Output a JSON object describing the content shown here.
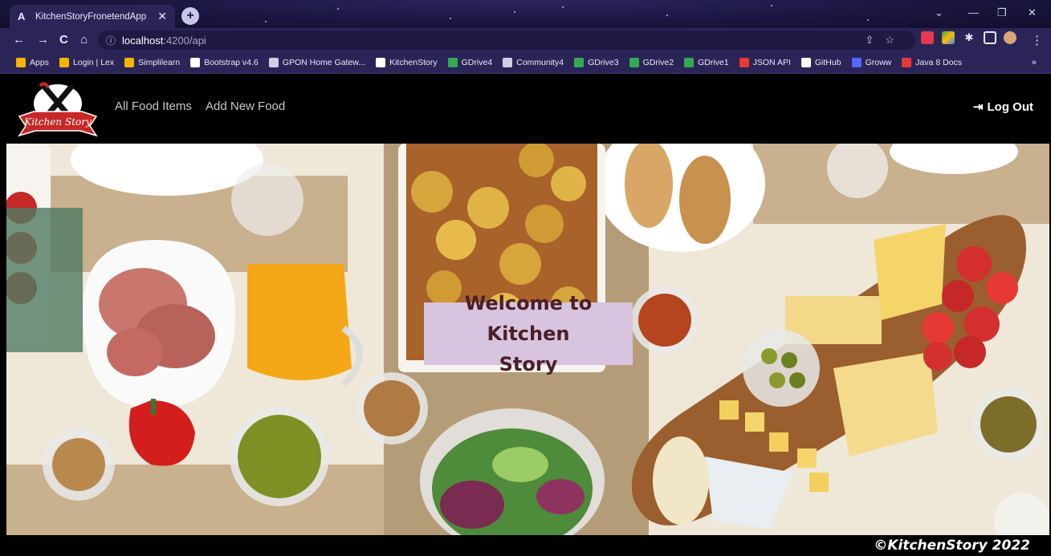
{
  "browser": {
    "tab_title": "KitchenStoryFronetendApp",
    "tab_favicon": "A",
    "url_host": "localhost",
    "url_path": ":4200/api",
    "bookmarks": [
      {
        "label": "Apps",
        "icon": "apps-grid-icon",
        "color": "#f4b400"
      },
      {
        "label": "Login | Lex",
        "icon": "lex-icon",
        "color": "#f4b400"
      },
      {
        "label": "Simplilearn",
        "icon": "simplilearn-icon",
        "color": "#f4b400"
      },
      {
        "label": "Bootstrap v4.6",
        "icon": "bootstrap-icon",
        "color": "#ffffff"
      },
      {
        "label": "GPON Home Gatew...",
        "icon": "globe-icon",
        "color": "#cfcde8"
      },
      {
        "label": "KitchenStory",
        "icon": "angular-icon",
        "color": "#ffffff"
      },
      {
        "label": "GDrive4",
        "icon": "gdrive-icon",
        "color": "#34a853"
      },
      {
        "label": "Community4",
        "icon": "globe-icon",
        "color": "#cfcde8"
      },
      {
        "label": "GDrive3",
        "icon": "gdrive-icon",
        "color": "#34a853"
      },
      {
        "label": "GDrive2",
        "icon": "gdrive-icon",
        "color": "#34a853"
      },
      {
        "label": "GDrive1",
        "icon": "gdrive-icon",
        "color": "#34a853"
      },
      {
        "label": "JSON API",
        "icon": "json-icon",
        "color": "#e53935"
      },
      {
        "label": "GitHub",
        "icon": "github-icon",
        "color": "#ffffff"
      },
      {
        "label": "Groww",
        "icon": "groww-icon",
        "color": "#5367ff"
      },
      {
        "label": "Java 8 Docs",
        "icon": "oracle-icon",
        "color": "#e53935"
      }
    ],
    "more_bookmarks": "»"
  },
  "app": {
    "logo_text": "Kitchen Story",
    "nav": {
      "all_food": "All Food Items",
      "add_food": "Add New Food",
      "logout": "Log Out"
    },
    "hero": {
      "welcome_line1": "Welcome to Kitchen",
      "welcome_line2": "Story"
    },
    "footer": {
      "copyright": "©KitchenStory 2022"
    }
  },
  "colors": {
    "navbar": "#000000",
    "welcome_box": "#d8c4df",
    "welcome_text": "#4a1f28",
    "browser_chrome": "#2b2557"
  }
}
